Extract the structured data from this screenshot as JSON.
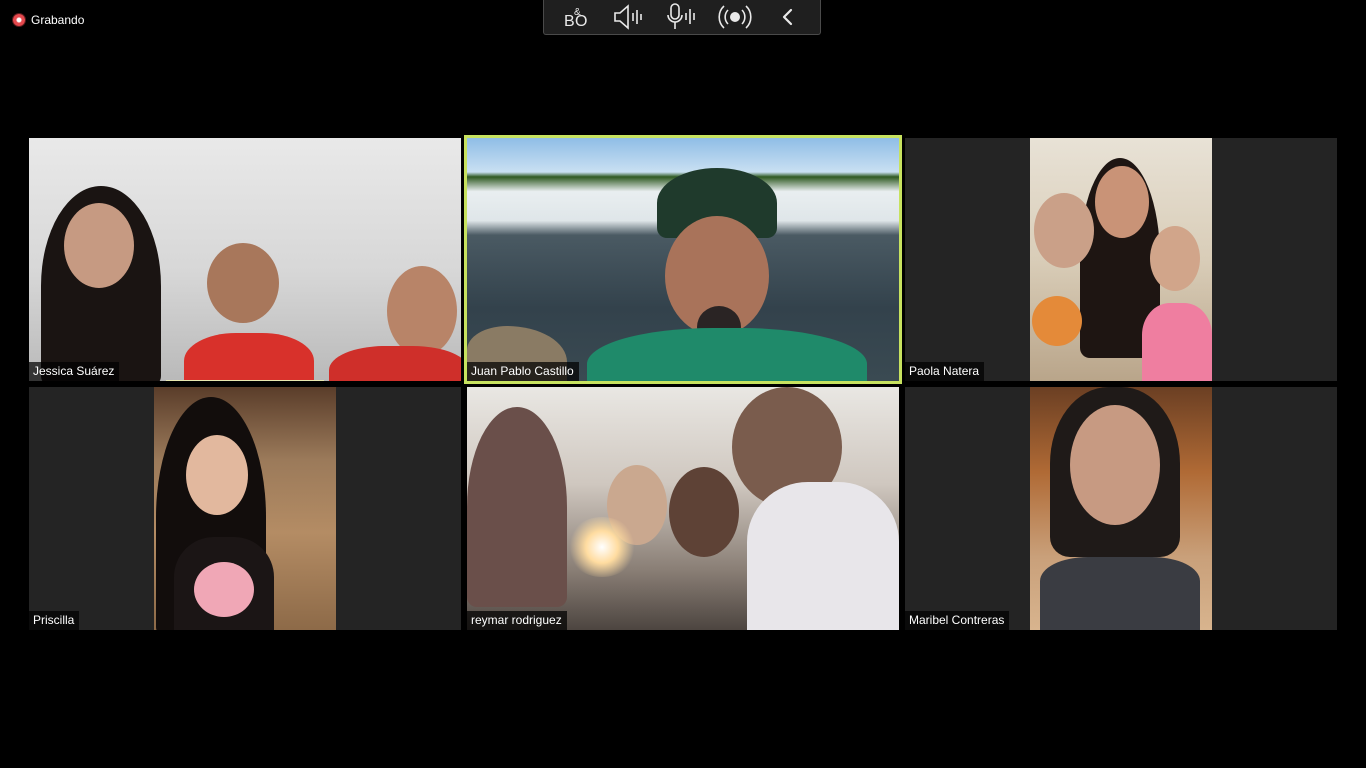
{
  "recording": {
    "label": "Grabando",
    "icon": "record-icon"
  },
  "toolbar": {
    "buttons": [
      {
        "name": "bo-app-button",
        "icon": "bang-olufsen-icon",
        "label": "B&O"
      },
      {
        "name": "speaker-volume-button",
        "icon": "speaker-icon"
      },
      {
        "name": "microphone-button",
        "icon": "microphone-icon"
      },
      {
        "name": "broadcast-button",
        "icon": "broadcast-icon"
      },
      {
        "name": "collapse-toolbar-button",
        "icon": "chevron-left-icon"
      }
    ]
  },
  "participants": [
    {
      "name": "Jessica Suárez",
      "speaking": true
    },
    {
      "name": "Juan Pablo Castillo",
      "active": true
    },
    {
      "name": "Paola Natera"
    },
    {
      "name": "Priscilla"
    },
    {
      "name": "reymar rodriguez"
    },
    {
      "name": "Maribel Contreras"
    }
  ],
  "colors": {
    "active_border": "#c7e25f",
    "tile_bg": "#242424",
    "recording_dot": "#e5484d"
  }
}
